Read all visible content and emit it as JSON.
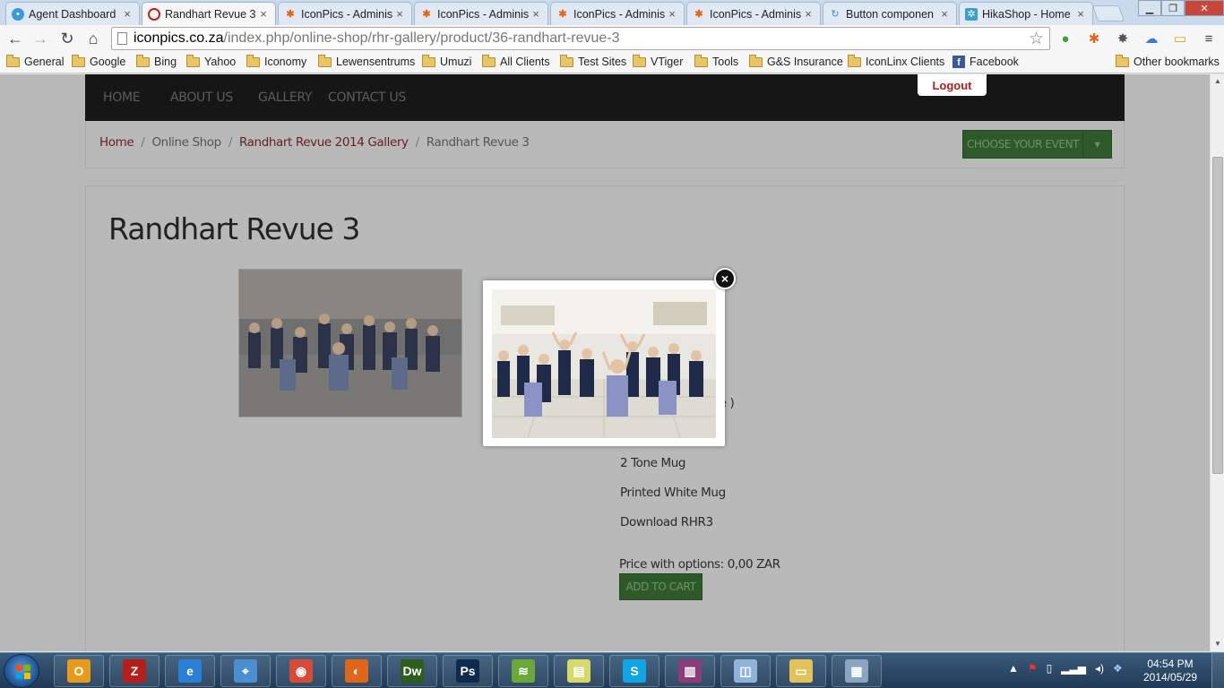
{
  "browser": {
    "tabs": [
      {
        "label": "Agent Dashboard",
        "icon": "chat-icon",
        "active": false
      },
      {
        "label": "Randhart Revue 3",
        "icon": "site-icon",
        "active": true
      },
      {
        "label": "IconPics - Adminis",
        "icon": "joomla-icon",
        "active": false
      },
      {
        "label": "IconPics - Adminis",
        "icon": "joomla-icon",
        "active": false
      },
      {
        "label": "IconPics - Adminis",
        "icon": "joomla-icon",
        "active": false
      },
      {
        "label": "IconPics - Adminis",
        "icon": "joomla-icon",
        "active": false
      },
      {
        "label": "Button componen",
        "icon": "loading-icon",
        "active": false
      },
      {
        "label": "HikaShop - Home",
        "icon": "hikashop-icon",
        "active": false
      }
    ],
    "url_domain": "iconpics.co.za",
    "url_path": "/index.php/online-shop/rhr-gallery/product/36-randhart-revue-3",
    "bookmarks": [
      "General",
      "Google",
      "Bing",
      "Yahoo",
      "Iconomy",
      "Lewensentrums",
      "Umuzi",
      "All Clients",
      "Test Sites",
      "VTiger",
      "Tools",
      "G&S Insurance",
      "IconLinx Clients",
      "Facebook"
    ],
    "other_bookmarks": "Other bookmarks"
  },
  "site": {
    "nav": [
      "HOME",
      "ABOUT US",
      "GALLERY",
      "CONTACT US"
    ],
    "logout": "Logout",
    "breadcrumb": {
      "home": "Home",
      "online_shop": "Online Shop",
      "gallery": "Randhart Revue 2014 Gallery",
      "current": "Randhart Revue 3",
      "separator": "/"
    },
    "choose_event": "CHOOSE YOUR EVENT",
    "product_title": "Randhart Revue 3",
    "options_partial": "ze )",
    "options": [
      "2 Tone Mug",
      "Printed White Mug",
      "Download RHR3"
    ],
    "price_label": "Price with options: 0,00 ZAR",
    "add_to_cart": "ADD TO CART"
  },
  "modal": {
    "close_symbol": "×"
  },
  "taskbar": {
    "apps": [
      {
        "name": "outlook",
        "glyph": "O",
        "color": "#e89a1c"
      },
      {
        "name": "filezilla",
        "glyph": "Z",
        "color": "#b3201b"
      },
      {
        "name": "internet-explorer",
        "glyph": "e",
        "color": "#2a7fd4"
      },
      {
        "name": "safari",
        "glyph": "⌖",
        "color": "#4a8fd0"
      },
      {
        "name": "chrome",
        "glyph": "◉",
        "color": "#d64a3a"
      },
      {
        "name": "firefox",
        "glyph": "◐",
        "color": "#e0661c"
      },
      {
        "name": "dreamweaver",
        "glyph": "Dw",
        "color": "#2e5e1e"
      },
      {
        "name": "photoshop",
        "glyph": "Ps",
        "color": "#0e2b4f"
      },
      {
        "name": "rawtherapee",
        "glyph": "≋",
        "color": "#6aa83a"
      },
      {
        "name": "sticky-notes",
        "glyph": "▤",
        "color": "#d7d86a"
      },
      {
        "name": "skype",
        "glyph": "S",
        "color": "#12a5e6"
      },
      {
        "name": "winrar",
        "glyph": "▥",
        "color": "#8a3d7a"
      },
      {
        "name": "note-app",
        "glyph": "◫",
        "color": "#8fb4d8"
      },
      {
        "name": "file-explorer",
        "glyph": "▭",
        "color": "#e2c25a"
      },
      {
        "name": "calculator",
        "glyph": "▦",
        "color": "#8aa4c4"
      }
    ],
    "time": "04:54 PM",
    "date": "2014/05/29"
  }
}
